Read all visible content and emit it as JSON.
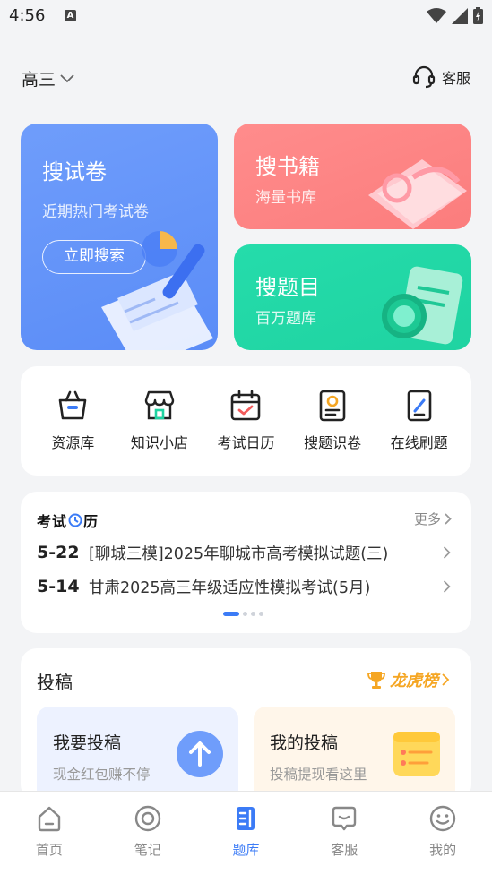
{
  "status_bar": {
    "time": "4:56",
    "badge": "A"
  },
  "header": {
    "grade": "高三",
    "service": "客服"
  },
  "cards": {
    "papers": {
      "title": "搜试卷",
      "subtitle": "近期热门考试卷",
      "button": "立即搜索"
    },
    "books": {
      "title": "搜书籍",
      "subtitle": "海量书库"
    },
    "questions": {
      "title": "搜题目",
      "subtitle": "百万题库"
    }
  },
  "tools": [
    {
      "label": "资源库",
      "icon": "basket-icon"
    },
    {
      "label": "知识小店",
      "icon": "shop-icon"
    },
    {
      "label": "考试日历",
      "icon": "calendar-icon"
    },
    {
      "label": "搜题识卷",
      "icon": "scan-doc-icon"
    },
    {
      "label": "在线刷题",
      "icon": "tablet-pen-icon"
    }
  ],
  "calendar": {
    "logo_left": "考试",
    "logo_right": "历",
    "more": "更多",
    "exams": [
      {
        "date": "5-22",
        "title": "[聊城三模]2025年聊城市高考模拟试题(三)"
      },
      {
        "date": "5-14",
        "title": "甘肃2025高三年级适应性模拟考试(5月)"
      }
    ]
  },
  "contribute": {
    "title": "投稿",
    "leaderboard": "龙虎榜",
    "submit": {
      "title": "我要投稿",
      "desc": "现金红包赚不停"
    },
    "mine": {
      "title": "我的投稿",
      "desc": "投稿提现看这里"
    }
  },
  "tabbar": [
    {
      "label": "首页",
      "icon": "home-icon",
      "active": false
    },
    {
      "label": "笔记",
      "icon": "notes-icon",
      "active": false
    },
    {
      "label": "题库",
      "icon": "question-bank-icon",
      "active": true
    },
    {
      "label": "客服",
      "icon": "chat-icon",
      "active": false
    },
    {
      "label": "我的",
      "icon": "smile-icon",
      "active": false
    }
  ],
  "colors": {
    "accent": "#3b7bf6",
    "papers_card": "#6f9dfb",
    "books_card": "#ff8c8c",
    "questions_card": "#25dcab",
    "leaderboard": "#f5a623"
  }
}
